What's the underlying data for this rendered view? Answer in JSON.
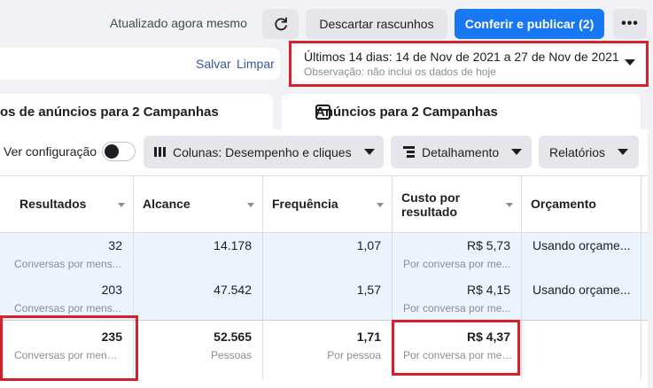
{
  "topbar": {
    "updated": "Atualizado agora mesmo",
    "refresh_icon": "refresh-icon",
    "discard_label": "Descartar rascunhos",
    "publish_label": "Conferir e publicar (2)",
    "more_label": "•••"
  },
  "filter": {
    "save_label": "Salvar",
    "clear_label": "Limpar"
  },
  "date_range": {
    "label": "Últimos 14 dias: 14 de Nov de 2021 a 27 de Nov de 2021",
    "note": "Observação: não inclui os dados de hoje"
  },
  "tabs": {
    "adsets": "os de anúncios para 2 Campanhas",
    "ads": "Anúncios para 2 Campanhas"
  },
  "toolbar": {
    "view_settings": "Ver configuração",
    "columns": "Colunas: Desempenho e cliques",
    "breakdown": "Detalhamento",
    "reports": "Relatórios"
  },
  "table": {
    "headers": [
      "Resultados",
      "Alcance",
      "Frequência",
      "Custo por resultado",
      "Orçamento"
    ],
    "header_cost_line1": "Custo por",
    "header_cost_line2": "resultado",
    "rows": [
      {
        "results": "32",
        "results_sub": "Conversas por mens...",
        "reach": "14.178",
        "frequency": "1,07",
        "cost": "R$ 5,73",
        "cost_sub": "Por conversa por me...",
        "budget": "Usando orçame..."
      },
      {
        "results": "203",
        "results_sub": "Conversas por mens...",
        "reach": "47.542",
        "frequency": "1,57",
        "cost": "R$ 4,15",
        "cost_sub": "Por conversa por me...",
        "budget": "Usando orçame..."
      }
    ],
    "totals": {
      "results": "235",
      "results_sub": "Conversas por mensa...",
      "reach": "52.565",
      "reach_sub": "Pessoas",
      "frequency": "1,71",
      "frequency_sub": "Por pessoa",
      "cost": "R$ 4,37",
      "cost_sub": "Por conversa por men..."
    }
  },
  "colors": {
    "accent": "#1877f2",
    "highlight": "#d6202b",
    "selected_row": "#ebf3fd"
  }
}
